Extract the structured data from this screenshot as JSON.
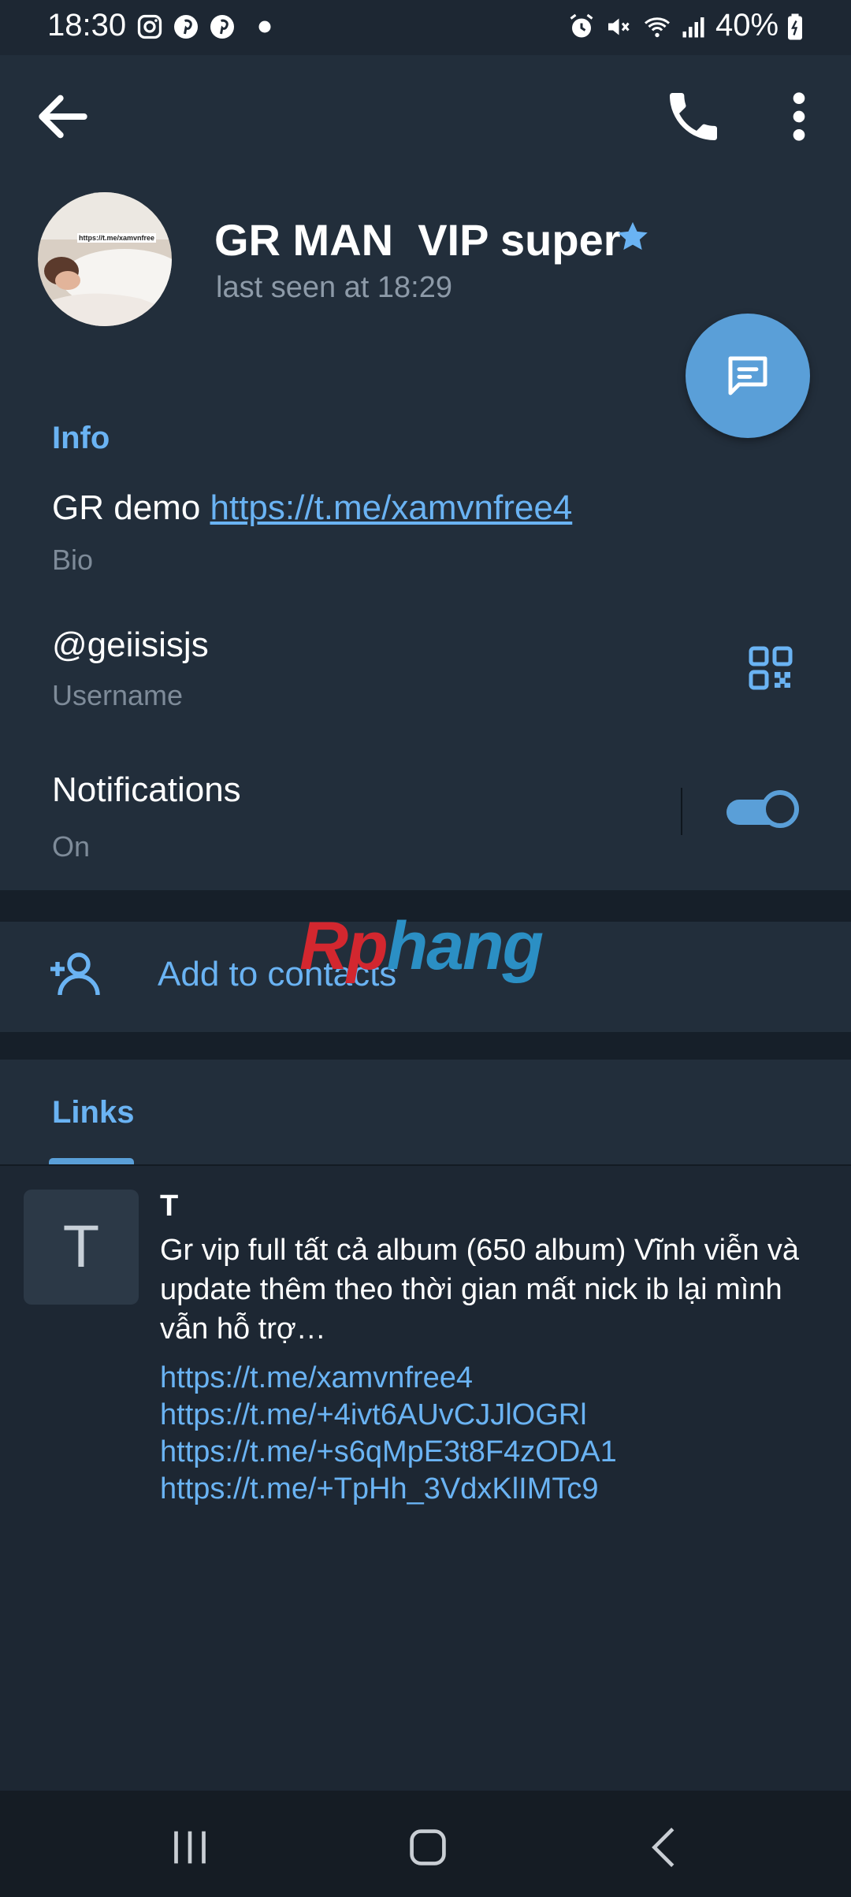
{
  "status_bar": {
    "time": "18:30",
    "left_icons": [
      "instagram-icon",
      "pinterest-icon",
      "pinterest-icon",
      "dot-icon"
    ],
    "right_icons": [
      "alarm-icon",
      "mute-icon",
      "wifi-icon",
      "signal-icon"
    ],
    "battery": "40%"
  },
  "header": {
    "title": "GR MAN  VIP super",
    "subtitle": "last seen at 18:29",
    "avatar_text": "https://t.me/xamvnfree",
    "colors": {
      "accent": "#6ab3f3",
      "background": "#222e3b"
    }
  },
  "info": {
    "section_title": "Info",
    "bio_prefix": "GR demo ",
    "bio_link": "https://t.me/xamvnfree4",
    "bio_label": "Bio",
    "username": "@geiisisjs",
    "username_label": "Username",
    "notifications_title": "Notifications",
    "notifications_value": "On",
    "notifications_on": true
  },
  "add_contact": {
    "label": "Add to contacts"
  },
  "watermark": {
    "part1": "Rp",
    "part2": "hang"
  },
  "links": {
    "tab_label": "Links",
    "items": [
      {
        "thumb_letter": "T",
        "title": "T",
        "description": "Gr vip full tất cả album (650 album) Vĩnh viễn và update thêm theo thời gian mất nick ib lại mình vẫn hỗ trợ…",
        "urls": [
          "https://t.me/xamvnfree4",
          "https://t.me/+4ivt6AUvCJJlOGRl",
          "https://t.me/+s6qMpE3t8F4zODA1",
          "https://t.me/+TpHh_3VdxKlIMTc9"
        ]
      }
    ]
  }
}
